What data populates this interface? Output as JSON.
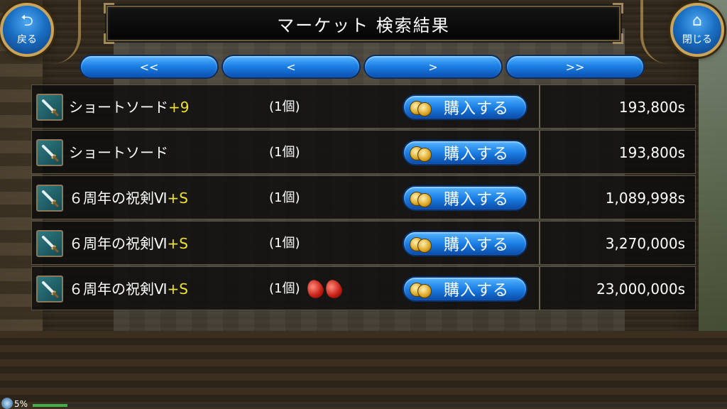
{
  "header": {
    "title": "マーケット 検索結果",
    "back_label": "戻る",
    "back_icon": "return-arrow-icon",
    "close_label": "閉じる",
    "close_icon": "home-icon"
  },
  "pager": {
    "first": "<<",
    "prev": "<",
    "next": ">",
    "last": ">>"
  },
  "buy_label": "購入する",
  "rows": [
    {
      "name": "ショートソード",
      "plus": "+9",
      "qty": "(1個)",
      "gems": 0,
      "price": "193,800s"
    },
    {
      "name": "ショートソード",
      "plus": "",
      "qty": "(1個)",
      "gems": 0,
      "price": "193,800s"
    },
    {
      "name": "６周年の祝剣Ⅵ",
      "plus": "+S",
      "qty": "(1個)",
      "gems": 0,
      "price": "1,089,998s"
    },
    {
      "name": "６周年の祝剣Ⅵ",
      "plus": "+S",
      "qty": "(1個)",
      "gems": 0,
      "price": "3,270,000s"
    },
    {
      "name": "６周年の祝剣Ⅵ",
      "plus": "+S",
      "qty": "(1個)",
      "gems": 2,
      "price": "23,000,000s"
    }
  ],
  "status": {
    "percent_text": "5%",
    "progress": 0.05
  },
  "colors": {
    "plus_text": "#f0e230",
    "button_blue": "#1c7fe4",
    "frame_gold": "#c9a45a",
    "gem_red": "#c41e14"
  }
}
